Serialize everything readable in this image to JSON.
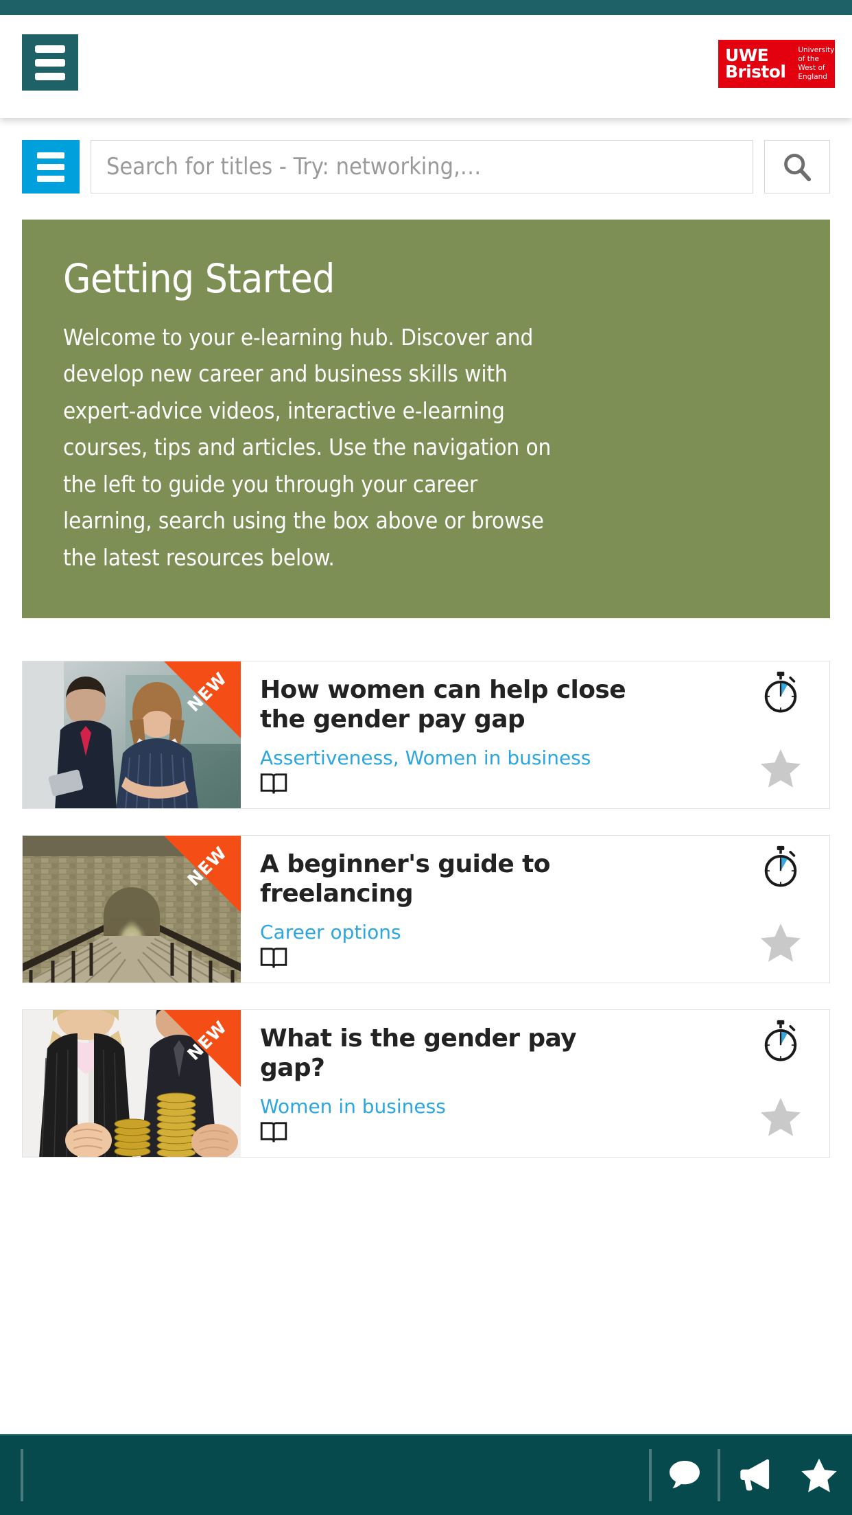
{
  "topbar": {
    "menu_icon": "hamburger-icon",
    "logo": {
      "main": "UWE\nBristol",
      "sub": "University\nof the\nWest of\nEngland",
      "brand_color": "#e3000f"
    }
  },
  "search": {
    "menu_icon": "hamburger-icon",
    "placeholder": "Search for titles - Try: networking,…",
    "value": "",
    "submit_icon": "search-icon"
  },
  "panel": {
    "title": "Getting Started",
    "body": "Welcome to your e-learning hub. Discover and develop new career and business skills with expert-advice videos, interactive e-learning courses, tips and articles. Use the navigation on the left to guide you through your career learning, search using the box above or browse the latest resources below.",
    "bg_color": "#7d8f55"
  },
  "cards": [
    {
      "ribbon": "NEW",
      "title": "How women can help close the gender pay gap",
      "tags": "Assertiveness, Women in business",
      "type_icon": "open-book-icon",
      "duration_icon": "stopwatch-icon",
      "favourite_icon": "star-icon",
      "favourited": false,
      "thumb_alt": "businessman-and-businesswoman"
    },
    {
      "ribbon": "NEW",
      "title": "A beginner's guide to freelancing",
      "tags": "Career options",
      "type_icon": "open-book-icon",
      "duration_icon": "stopwatch-icon",
      "favourite_icon": "star-icon",
      "favourited": false,
      "thumb_alt": "stone-tunnel-bridge-walkway"
    },
    {
      "ribbon": "NEW",
      "title": "What is the gender pay gap?",
      "tags": "Women in business",
      "type_icon": "open-book-icon",
      "duration_icon": "stopwatch-icon",
      "favourite_icon": "star-icon",
      "favourited": false,
      "thumb_alt": "man-and-woman-with-coin-stacks"
    }
  ],
  "footer": {
    "bg_color": "#064a4e",
    "items": [
      {
        "icon": "chat-bubble-icon"
      },
      {
        "icon": "megaphone-icon"
      },
      {
        "icon": "star-icon"
      }
    ]
  },
  "colors": {
    "teal": "#1e6268",
    "blue": "#00a0dd",
    "link_blue": "#2ba6e0",
    "ribbon_orange": "#f44d16",
    "star_grey": "#c9c9c9"
  }
}
